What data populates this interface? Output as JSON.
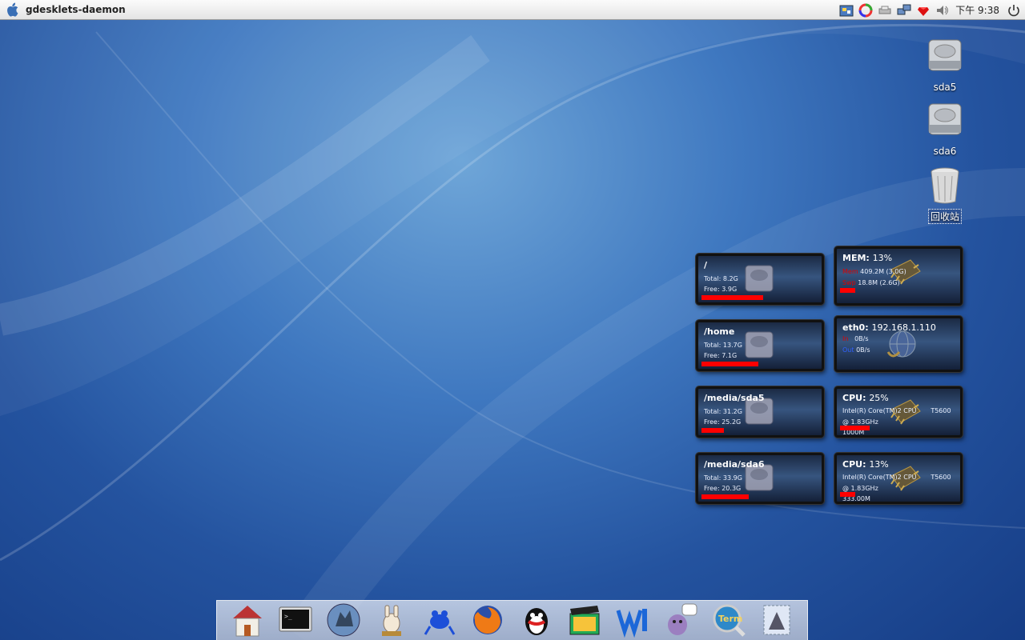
{
  "panel": {
    "app_title": "gdesklets-daemon",
    "clock": "下午 9:38"
  },
  "desktop_icons": [
    {
      "label": "sda5"
    },
    {
      "label": "sda6"
    },
    {
      "label": "回收站"
    }
  ],
  "disk_desklets": [
    {
      "mount": "/",
      "total": "Total: 8.2G",
      "free": "Free: 3.9G",
      "used_fraction": 0.52
    },
    {
      "mount": "/home",
      "total": "Total: 13.7G",
      "free": "Free: 7.1G",
      "used_fraction": 0.48
    },
    {
      "mount": "/media/sda5",
      "total": "Total: 31.2G",
      "free": "Free: 25.2G",
      "used_fraction": 0.19
    },
    {
      "mount": "/media/sda6",
      "total": "Total: 33.9G",
      "free": "Free: 20.3G",
      "used_fraction": 0.4
    }
  ],
  "mem_desklet": {
    "title": "MEM:",
    "percent": "13%",
    "mem_label": "Mem",
    "mem_value": "409.2M (3.0G)",
    "swap_label": "Swp",
    "swap_value": "18.8M (2.6G)",
    "used_fraction": 0.13
  },
  "net_desklet": {
    "title": "eth0:",
    "ip": "192.168.1.110",
    "in_label": "In",
    "in_value": "0B/s",
    "out_label": "Out",
    "out_value": "0B/s"
  },
  "cpu_desklets": [
    {
      "title": "CPU:",
      "percent": "25%",
      "model": "Intel(R) Core(TM)2 CPU",
      "model_suffix": "T5600",
      "speed": "@ 1.83GHz",
      "freq": "1000M",
      "used_fraction": 0.25
    },
    {
      "title": "CPU:",
      "percent": "13%",
      "model": "Intel(R) Core(TM)2 CPU",
      "model_suffix": "T5600",
      "speed": "@ 1.83GHz",
      "freq": "333.00M",
      "used_fraction": 0.13
    }
  ],
  "dock": {
    "items": [
      "home-icon",
      "terminal-icon",
      "wolf-icon",
      "donkey-icon",
      "frog-icon",
      "firefox-icon",
      "qq-penguin-icon",
      "movie-clapper-icon",
      "word-icon",
      "pidgin-icon",
      "term-icon",
      "stamp-icon"
    ],
    "term_label": "Term"
  },
  "colors": {
    "bar": "#ff0000",
    "panel": "#f0f0f0",
    "accent_red": "#dd0000",
    "accent_blue": "#3060ff"
  }
}
